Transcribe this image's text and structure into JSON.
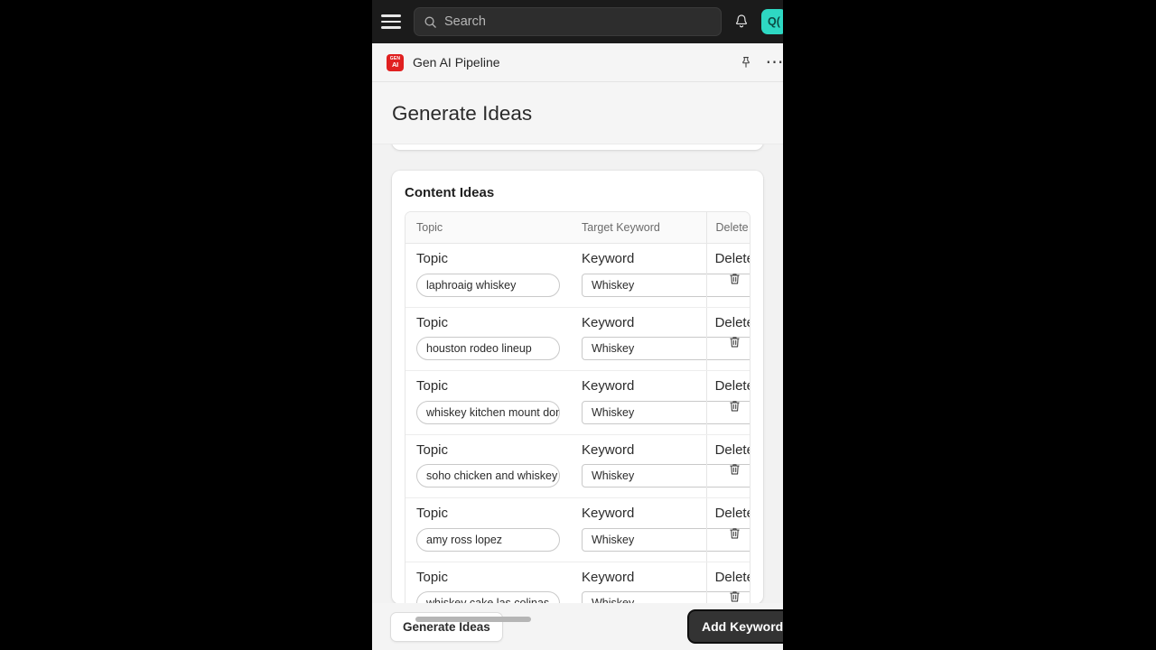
{
  "topbar": {
    "menu_icon": "hamburger-menu-icon",
    "search": {
      "placeholder": "Search",
      "value": "",
      "icon": "search-icon"
    },
    "notifications_icon": "bell-icon",
    "avatar_initials": "Q("
  },
  "appbar": {
    "logo_line1": "GEN",
    "logo_line2": "AI",
    "title": "Gen AI Pipeline",
    "pin_icon": "pin-icon",
    "more_icon": "ellipsis-icon"
  },
  "page": {
    "title": "Generate Ideas"
  },
  "ideas_card": {
    "heading": "Content Ideas",
    "columns": [
      "Topic",
      "Target Keyword",
      "Delete"
    ],
    "row_labels": {
      "topic": "Topic",
      "keyword": "Keyword",
      "delete": "Delete"
    },
    "rows": [
      {
        "topic": "laphroaig whiskey",
        "keyword": "Whiskey"
      },
      {
        "topic": "houston rodeo lineup",
        "keyword": "Whiskey"
      },
      {
        "topic": "whiskey kitchen mount dora",
        "keyword": "Whiskey"
      },
      {
        "topic": "soho chicken and whiskey",
        "keyword": "Whiskey"
      },
      {
        "topic": "amy ross lopez",
        "keyword": "Whiskey"
      },
      {
        "topic": "whiskey cake las colinas",
        "keyword": "Whiskey"
      }
    ]
  },
  "bottombar": {
    "generate_label": "Generate Ideas",
    "add_keywords_label": "Add Keywords"
  },
  "colors": {
    "topbar_bg": "#1b1b1b",
    "avatar_bg": "#2ed8c3",
    "logo_bg": "#e02020",
    "primary_btn_bg": "#333333",
    "page_bg": "#f2f2f2"
  }
}
